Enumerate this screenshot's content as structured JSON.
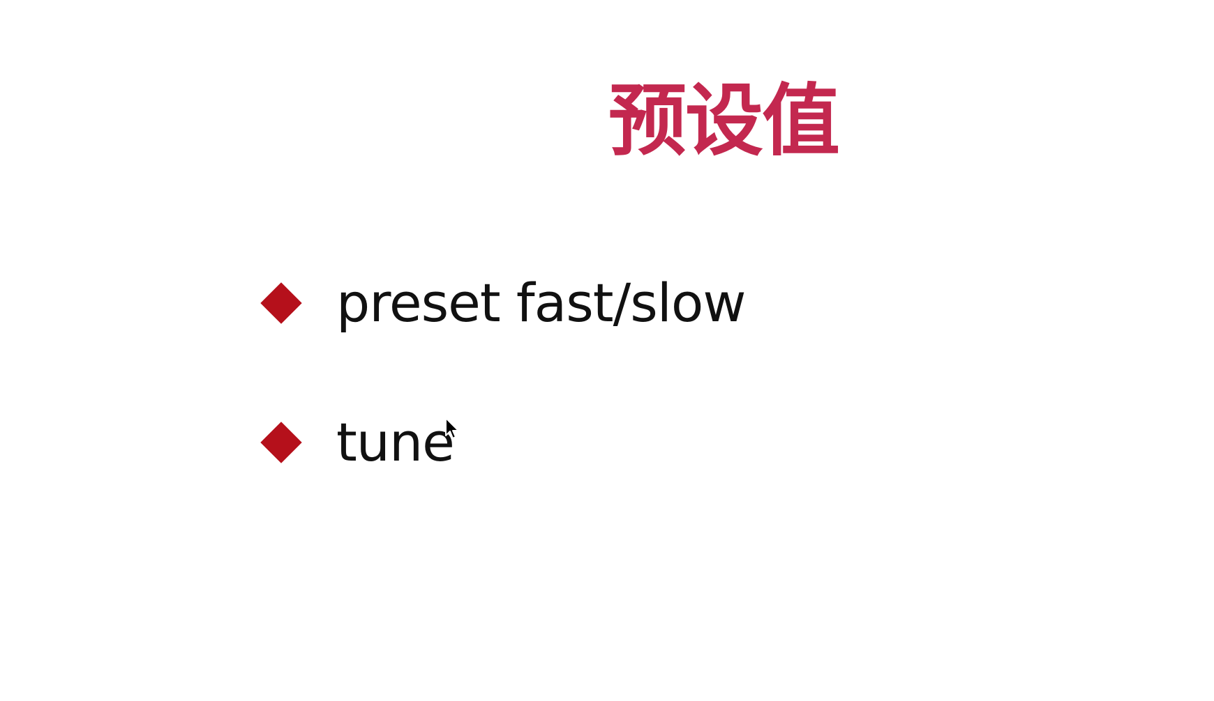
{
  "slide": {
    "title": "预设值",
    "bullets": [
      {
        "text": "preset fast/slow"
      },
      {
        "text": "tune"
      }
    ]
  },
  "colors": {
    "title": "#c3284f",
    "bullet_marker": "#b5101b",
    "text": "#111111",
    "background": "#ffffff"
  },
  "icons": {
    "bullet_marker": "diamond-bullet-icon",
    "cursor": "mouse-pointer-icon"
  }
}
